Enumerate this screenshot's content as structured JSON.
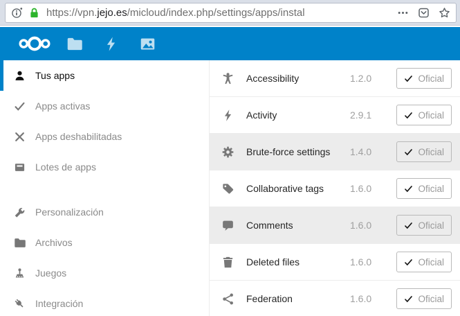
{
  "browser": {
    "url": {
      "prefix": "https://vpn.",
      "domain": "jejo.es",
      "path": "/micloud/index.php/settings/apps/instal"
    },
    "identity_icons": [
      {
        "name": "page-info",
        "icon": "info-icon"
      },
      {
        "name": "secure-lock",
        "icon": "lock-icon"
      }
    ],
    "action_icons": [
      {
        "name": "page-actions",
        "icon": "ellipsis-icon"
      },
      {
        "name": "save-to-pocket",
        "icon": "pocket-icon"
      },
      {
        "name": "bookmark-star",
        "icon": "star-icon"
      }
    ]
  },
  "header": {
    "logo_icon": "nextcloud-logo-icon",
    "nav_icons": [
      {
        "name": "files",
        "icon": "folder-icon"
      },
      {
        "name": "activity",
        "icon": "lightning-icon"
      },
      {
        "name": "gallery",
        "icon": "image-icon"
      }
    ]
  },
  "sidebar": {
    "items": [
      {
        "label": "Tus apps",
        "icon": "user-icon",
        "selected": true,
        "gap_after": false
      },
      {
        "label": "Apps activas",
        "icon": "check-icon",
        "selected": false,
        "gap_after": false
      },
      {
        "label": "Apps deshabilitadas",
        "icon": "close-icon",
        "selected": false,
        "gap_after": false
      },
      {
        "label": "Lotes de apps",
        "icon": "bundle-icon",
        "selected": false,
        "gap_after": true
      },
      {
        "label": "Personalización",
        "icon": "wrench-icon",
        "selected": false,
        "gap_after": false
      },
      {
        "label": "Archivos",
        "icon": "folder-icon",
        "selected": false,
        "gap_after": false
      },
      {
        "label": "Juegos",
        "icon": "joystick-icon",
        "selected": false,
        "gap_after": false
      },
      {
        "label": "Integración",
        "icon": "plug-icon",
        "selected": false,
        "gap_after": false
      }
    ]
  },
  "apps": {
    "rows": [
      {
        "name": "Accessibility",
        "version": "1.2.0",
        "badge": "Oficial",
        "icon": "accessibility-icon",
        "highlighted": false
      },
      {
        "name": "Activity",
        "version": "2.9.1",
        "badge": "Oficial",
        "icon": "lightning-icon",
        "highlighted": false
      },
      {
        "name": "Brute-force settings",
        "version": "1.4.0",
        "badge": "Oficial",
        "icon": "gear-icon",
        "highlighted": true
      },
      {
        "name": "Collaborative tags",
        "version": "1.6.0",
        "badge": "Oficial",
        "icon": "tag-icon",
        "highlighted": false
      },
      {
        "name": "Comments",
        "version": "1.6.0",
        "badge": "Oficial",
        "icon": "comment-icon",
        "highlighted": true
      },
      {
        "name": "Deleted files",
        "version": "1.6.0",
        "badge": "Oficial",
        "icon": "trash-icon",
        "highlighted": false
      },
      {
        "name": "Federation",
        "version": "1.6.0",
        "badge": "Oficial",
        "icon": "share-icon",
        "highlighted": false
      }
    ]
  },
  "colors": {
    "accent": "#0082c9",
    "lock_green": "#2db42c",
    "row_highlight": "#ececec",
    "chrome_bg": "#dadfe8"
  }
}
